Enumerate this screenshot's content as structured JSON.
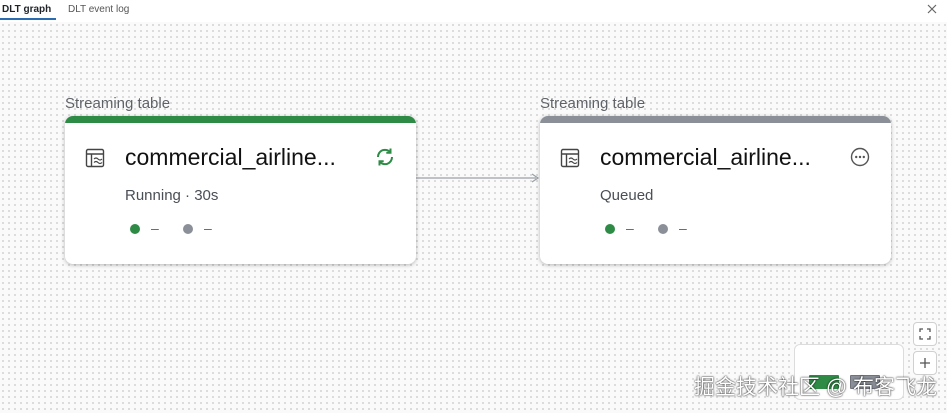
{
  "tabs": [
    {
      "label": "DLT graph",
      "active": true
    },
    {
      "label": "DLT event log",
      "active": false
    }
  ],
  "icons": {
    "close": "close-icon",
    "table": "streaming-table-icon",
    "running": "refresh-icon",
    "queued": "more-horizontal-icon",
    "fit_view": "fit-view-icon",
    "zoom_in": "plus-icon"
  },
  "colors": {
    "running": "#2e8b46",
    "queued": "#8a8f98",
    "metric_green": "#2e8b46",
    "metric_grey": "#8a8f98",
    "tab_underline": "#2b6cb0"
  },
  "nodes": [
    {
      "caption": "Streaming table",
      "title": "commercial_airline...",
      "status": "Running · 30s",
      "state": "running",
      "metrics": [
        {
          "value": "–",
          "color": "green"
        },
        {
          "value": "–",
          "color": "grey"
        }
      ]
    },
    {
      "caption": "Streaming table",
      "title": "commercial_airline...",
      "status": "Queued",
      "state": "queued",
      "metrics": [
        {
          "value": "–",
          "color": "green"
        },
        {
          "value": "–",
          "color": "grey"
        }
      ]
    }
  ],
  "minimap": {
    "nodes": [
      {
        "state": "running"
      },
      {
        "state": "queued"
      }
    ]
  },
  "watermark": "掘金技术社区 @ 布客飞龙"
}
